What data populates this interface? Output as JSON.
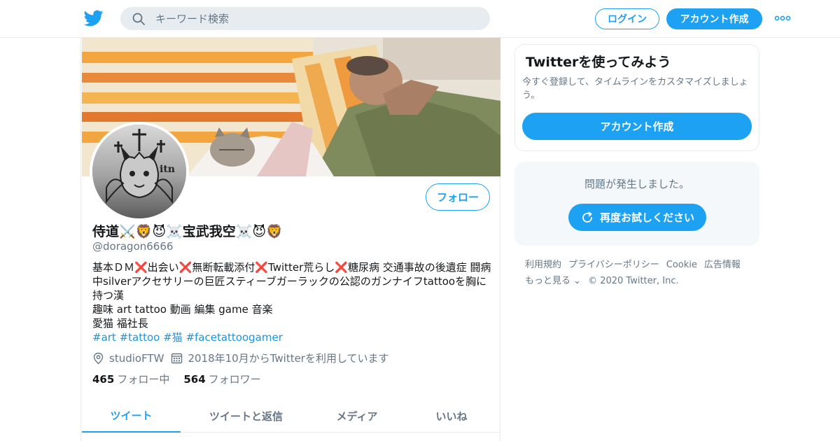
{
  "header": {
    "logo_icon": "twitter-bird-icon",
    "search_placeholder": "キーワード検索",
    "login_label": "ログイン",
    "signup_label": "アカウント作成",
    "more_icon": "more-dots-icon"
  },
  "profile": {
    "display_name": "侍道⚔️🦁😈☠️宝武我空☠️😈🦁",
    "handle": "@doragon6666",
    "follow_label": "フォロー",
    "bio_lines": [
      "基本ＤＭ❌出会い❌無断転載添付❌Twitter荒らし❌糖尿病 交通事故の後遺症 闘病中silverアクセサリーの巨匠スティーブガーラックの公認のガンナイフtattooを胸に持つ漢",
      "趣味 art tattoo 動画 編集 game 音楽",
      "愛猫 福社長"
    ],
    "bio_tags": "#art #tattoo #猫 #facetattoogamer",
    "location": "studioFTW",
    "joined": "2018年10月からTwitterを利用しています",
    "following_count": "465",
    "following_label": "フォロー中",
    "followers_count": "564",
    "followers_label": "フォロワー",
    "tabs": [
      "ツイート",
      "ツイートと返信",
      "メディア",
      "いいね"
    ]
  },
  "sidebar": {
    "signup_title": "Twitterを使ってみよう",
    "signup_desc": "今すぐ登録して、タイムラインをカスタマイズしましょう。",
    "signup_button": "アカウント作成",
    "error_message": "問題が発生しました。",
    "retry_label": "再度お試しください"
  },
  "footer": {
    "links_row1": [
      "利用規約",
      "プライバシーポリシー",
      "Cookie",
      "広告情報"
    ],
    "more_label": "もっと見る",
    "copyright": "© 2020 Twitter, Inc."
  },
  "colors": {
    "accent": "#1da1f2",
    "text_secondary": "#657786",
    "link": "#1b95e0"
  }
}
